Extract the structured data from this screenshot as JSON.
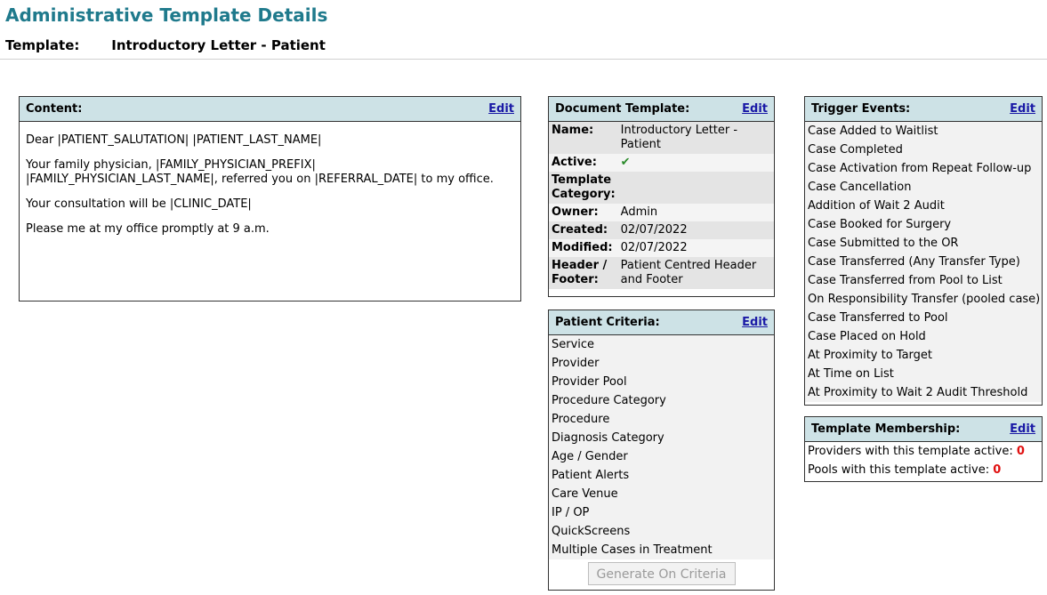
{
  "page": {
    "title": "Administrative Template Details",
    "template_label": "Template:",
    "template_name": "Introductory Letter - Patient"
  },
  "content": {
    "header": "Content:",
    "edit": "Edit",
    "paragraphs": [
      "Dear |PATIENT_SALUTATION| |PATIENT_LAST_NAME|",
      "Your family physician, |FAMILY_PHYSICIAN_PREFIX| |FAMILY_PHYSICIAN_LAST_NAME|, referred you on |REFERRAL_DATE| to my office.",
      "Your consultation will be |CLINIC_DATE|",
      "Please me at my office promptly at 9 a.m."
    ]
  },
  "document_template": {
    "header": "Document Template:",
    "edit": "Edit",
    "rows": [
      {
        "label": "Name:",
        "value": "Introductory Letter - Patient"
      },
      {
        "label": "Active:",
        "value": "✔"
      },
      {
        "label": "Template Category:",
        "value": ""
      },
      {
        "label": "Owner:",
        "value": "Admin"
      },
      {
        "label": "Created:",
        "value": "02/07/2022"
      },
      {
        "label": "Modified:",
        "value": "02/07/2022"
      },
      {
        "label": "Header / Footer:",
        "value": "Patient Centred Header and Footer"
      }
    ]
  },
  "patient_criteria": {
    "header": "Patient Criteria:",
    "edit": "Edit",
    "items": [
      "Service",
      "Provider",
      "Provider Pool",
      "Procedure Category",
      "Procedure",
      "Diagnosis Category",
      "Age / Gender",
      "Patient Alerts",
      "Care Venue",
      "IP / OP",
      "QuickScreens",
      "Multiple Cases in Treatment"
    ],
    "button": "Generate On Criteria"
  },
  "trigger_events": {
    "header": "Trigger Events:",
    "edit": "Edit",
    "items": [
      "Case Added to Waitlist",
      "Case Completed",
      "Case Activation from Repeat Follow-up",
      "Case Cancellation",
      "Addition of Wait 2 Audit",
      "Case Booked for Surgery",
      "Case Submitted to the OR",
      "Case Transferred (Any Transfer Type)",
      "Case Transferred from Pool to List",
      "On Responsibility Transfer (pooled case)",
      "Case Transferred to Pool",
      "Case Placed on Hold",
      "At Proximity to Target",
      "At Time on List",
      "At Proximity to Wait 2 Audit Threshold"
    ]
  },
  "template_membership": {
    "header": "Template Membership:",
    "edit": "Edit",
    "providers_label": "Providers with this template active:",
    "providers_count": "0",
    "pools_label": "Pools with this template active:",
    "pools_count": "0"
  },
  "colors": {
    "title": "#1f7a8c",
    "panel_header_bg": "#cde2e6",
    "link": "#1a1aa6",
    "count": "#e01010",
    "check": "#2a8a2a"
  }
}
